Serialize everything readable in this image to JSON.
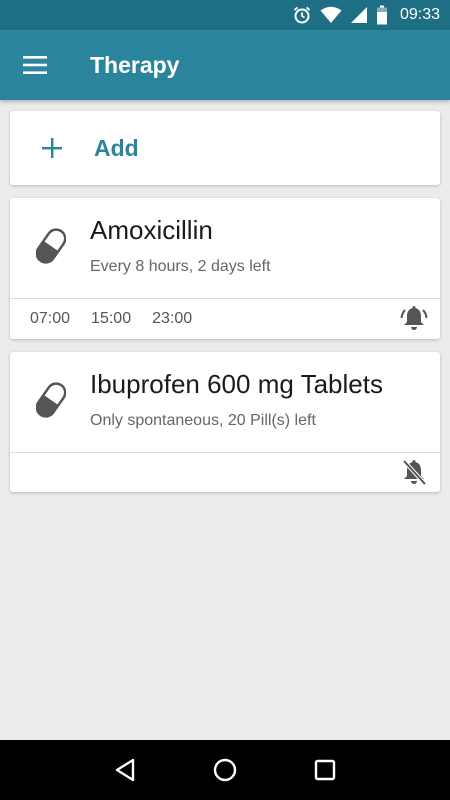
{
  "status_bar": {
    "time": "09:33"
  },
  "app_bar": {
    "title": "Therapy"
  },
  "add": {
    "label": "Add"
  },
  "medications": [
    {
      "name": "Amoxicillin",
      "subtitle": "Every 8 hours, 2 days left",
      "times": [
        "07:00",
        "15:00",
        "23:00"
      ],
      "alarm": "alarm-active-icon"
    },
    {
      "name": "Ibuprofen 600 mg Tablets",
      "subtitle": "Only spontaneous, 20 Pill(s) left",
      "times": [],
      "alarm": "alarm-off-icon"
    }
  ],
  "colors": {
    "status_bar": "#1f6f84",
    "app_bar": "#2a849b",
    "accent": "#2a849b",
    "background": "#ececec"
  }
}
